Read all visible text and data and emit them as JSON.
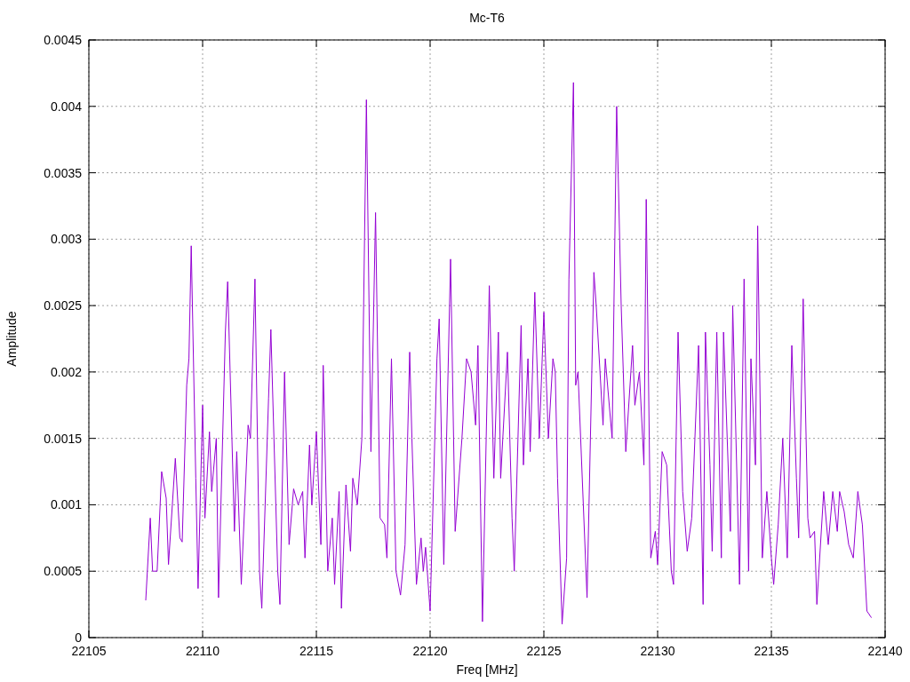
{
  "chart_data": {
    "type": "line",
    "grid": true,
    "title": "Mc-T6",
    "xlabel": "Freq [MHz]",
    "ylabel": "Amplitude",
    "xlim": [
      22105,
      22140
    ],
    "ylim": [
      0,
      0.0045
    ],
    "xticks": [
      22105,
      22110,
      22115,
      22120,
      22125,
      22130,
      22135,
      22140
    ],
    "yticks": [
      0,
      0.0005,
      0.001,
      0.0015,
      0.002,
      0.0025,
      0.003,
      0.0035,
      0.004,
      0.0045
    ],
    "x": [
      22107.5,
      22107.7,
      22107.8,
      22108.0,
      22108.2,
      22108.4,
      22108.5,
      22108.8,
      22109.0,
      22109.1,
      22109.3,
      22109.4,
      22109.5,
      22109.7,
      22109.8,
      22110.0,
      22110.1,
      22110.3,
      22110.4,
      22110.6,
      22110.7,
      22111.0,
      22111.1,
      22111.4,
      22111.5,
      22111.7,
      22112.0,
      22112.1,
      22112.3,
      22112.5,
      22112.6,
      22112.9,
      22113.0,
      22113.3,
      22113.4,
      22113.6,
      22113.8,
      22114.0,
      22114.2,
      22114.4,
      22114.5,
      22114.7,
      22114.8,
      22115.0,
      22115.2,
      22115.3,
      22115.5,
      22115.7,
      22115.8,
      22116.0,
      22116.1,
      22116.3,
      22116.5,
      22116.6,
      22116.8,
      22117.0,
      22117.2,
      22117.4,
      22117.6,
      22117.8,
      22118.0,
      22118.1,
      22118.3,
      22118.5,
      22118.7,
      22118.9,
      22119.1,
      22119.2,
      22119.4,
      22119.6,
      22119.7,
      22119.8,
      22120.0,
      22120.3,
      22120.4,
      22120.6,
      22120.9,
      22121.1,
      22121.4,
      22121.6,
      22121.8,
      22122.0,
      22122.1,
      22122.3,
      22122.6,
      22122.8,
      22123.0,
      22123.1,
      22123.4,
      22123.6,
      22123.7,
      22124.0,
      22124.1,
      22124.3,
      22124.4,
      22124.6,
      22124.8,
      22125.0,
      22125.2,
      22125.4,
      22125.5,
      22125.6,
      22125.8,
      22126.0,
      22126.1,
      22126.3,
      22126.4,
      22126.5,
      22126.9,
      22127.2,
      22127.3,
      22127.6,
      22127.7,
      22128.0,
      22128.2,
      22128.4,
      22128.6,
      22128.9,
      22129.0,
      22129.2,
      22129.4,
      22129.5,
      22129.7,
      22129.9,
      22130.0,
      22130.2,
      22130.4,
      22130.6,
      22130.7,
      22130.9,
      22131.1,
      22131.3,
      22131.5,
      22131.8,
      22132.0,
      22132.1,
      22132.3,
      22132.4,
      22132.6,
      22132.8,
      22132.9,
      22133.2,
      22133.3,
      22133.6,
      22133.8,
      22134.0,
      22134.1,
      22134.3,
      22134.4,
      22134.6,
      22134.8,
      22135.0,
      22135.1,
      22135.3,
      22135.5,
      22135.7,
      22135.9,
      22136.1,
      22136.2,
      22136.4,
      22136.6,
      22136.7,
      22136.9,
      22137.0,
      22137.3,
      22137.5,
      22137.7,
      22137.9,
      22138.0,
      22138.2,
      22138.4,
      22138.6,
      22138.8,
      22139.0,
      22139.2,
      22139.4
    ],
    "series": [
      {
        "color": "#9400d3",
        "values": [
          0.00028,
          0.0009,
          0.0005,
          0.0005,
          0.00125,
          0.00105,
          0.00055,
          0.00135,
          0.00075,
          0.00072,
          0.0019,
          0.0021,
          0.00295,
          0.0012,
          0.00037,
          0.00175,
          0.0009,
          0.00155,
          0.0011,
          0.0015,
          0.0003,
          0.0023,
          0.00268,
          0.0008,
          0.0014,
          0.0004,
          0.0016,
          0.0015,
          0.0027,
          0.0005,
          0.00022,
          0.0018,
          0.00232,
          0.0005,
          0.00025,
          0.002,
          0.0007,
          0.00112,
          0.001,
          0.0011,
          0.0006,
          0.00145,
          0.001,
          0.00155,
          0.0007,
          0.00205,
          0.0005,
          0.0009,
          0.0004,
          0.0011,
          0.00022,
          0.00115,
          0.00065,
          0.0012,
          0.001,
          0.0015,
          0.00405,
          0.0014,
          0.0032,
          0.0009,
          0.00085,
          0.0006,
          0.0021,
          0.0005,
          0.00032,
          0.0007,
          0.00215,
          0.0015,
          0.0004,
          0.00075,
          0.0005,
          0.00068,
          0.0002,
          0.0021,
          0.0024,
          0.00055,
          0.00285,
          0.0008,
          0.0015,
          0.0021,
          0.002,
          0.0016,
          0.0022,
          0.00012,
          0.00265,
          0.0012,
          0.0023,
          0.0012,
          0.00215,
          0.0009,
          0.0005,
          0.00235,
          0.0013,
          0.0021,
          0.0014,
          0.0026,
          0.0015,
          0.00245,
          0.0015,
          0.0021,
          0.002,
          0.0012,
          0.0001,
          0.0006,
          0.0027,
          0.00418,
          0.0019,
          0.002,
          0.0003,
          0.00275,
          0.0025,
          0.0016,
          0.0021,
          0.0015,
          0.004,
          0.0025,
          0.0014,
          0.0022,
          0.00175,
          0.002,
          0.0013,
          0.0033,
          0.0006,
          0.0008,
          0.00055,
          0.0014,
          0.0013,
          0.0005,
          0.0004,
          0.0023,
          0.0011,
          0.00065,
          0.0009,
          0.0022,
          0.00025,
          0.0023,
          0.0013,
          0.00065,
          0.0023,
          0.0006,
          0.0023,
          0.0008,
          0.0025,
          0.0004,
          0.0027,
          0.0005,
          0.0021,
          0.0013,
          0.0031,
          0.0006,
          0.0011,
          0.0006,
          0.0004,
          0.00085,
          0.0015,
          0.0006,
          0.0022,
          0.0012,
          0.00075,
          0.00255,
          0.0009,
          0.00075,
          0.0008,
          0.00025,
          0.0011,
          0.0007,
          0.0011,
          0.0008,
          0.0011,
          0.00095,
          0.0007,
          0.0006,
          0.0011,
          0.00085,
          0.0002,
          0.00015
        ]
      }
    ]
  }
}
